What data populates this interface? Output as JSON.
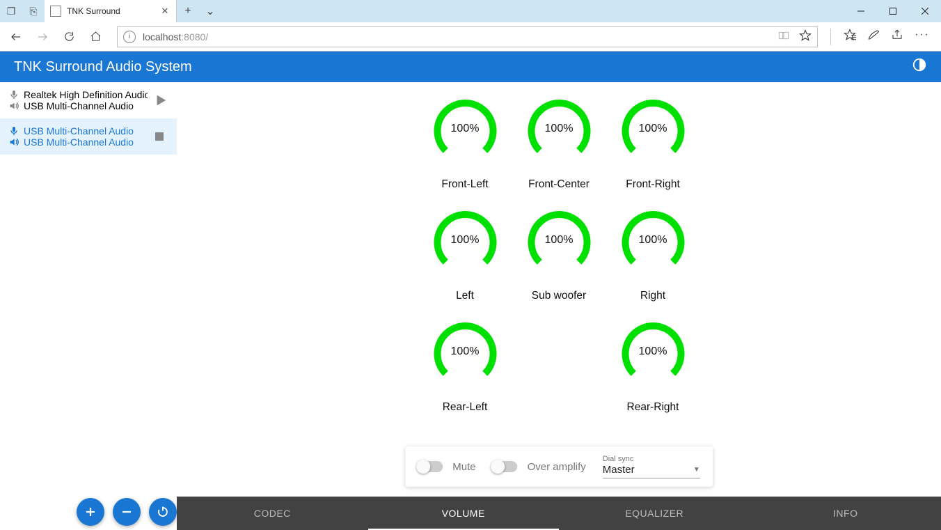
{
  "browser": {
    "tab_title": "TNK Surround",
    "url_host": "localhost",
    "url_rest": ":8080/"
  },
  "header": {
    "title": "TNK Surround Audio System"
  },
  "sidebar": {
    "devices": [
      {
        "input": "Realtek High Definition Audio",
        "output": "USB Multi-Channel Audio",
        "selected": false,
        "action": "play"
      },
      {
        "input": "USB Multi-Channel Audio",
        "output": "USB Multi-Channel Audio",
        "selected": true,
        "action": "stop"
      }
    ]
  },
  "gauges": [
    {
      "value": "100%",
      "label": "Front-Left"
    },
    {
      "value": "100%",
      "label": "Front-Center"
    },
    {
      "value": "100%",
      "label": "Front-Right"
    },
    {
      "value": "100%",
      "label": "Left"
    },
    {
      "value": "100%",
      "label": "Sub woofer"
    },
    {
      "value": "100%",
      "label": "Right"
    },
    {
      "value": "100%",
      "label": "Rear-Left"
    },
    null,
    {
      "value": "100%",
      "label": "Rear-Right"
    }
  ],
  "controls": {
    "mute_label": "Mute",
    "over_amplify_label": "Over amplify",
    "dial_sync_label": "Dial sync",
    "dial_sync_value": "Master"
  },
  "tabs": {
    "items": [
      "CODEC",
      "VOLUME",
      "EQUALIZER",
      "INFO"
    ],
    "active_index": 1
  }
}
